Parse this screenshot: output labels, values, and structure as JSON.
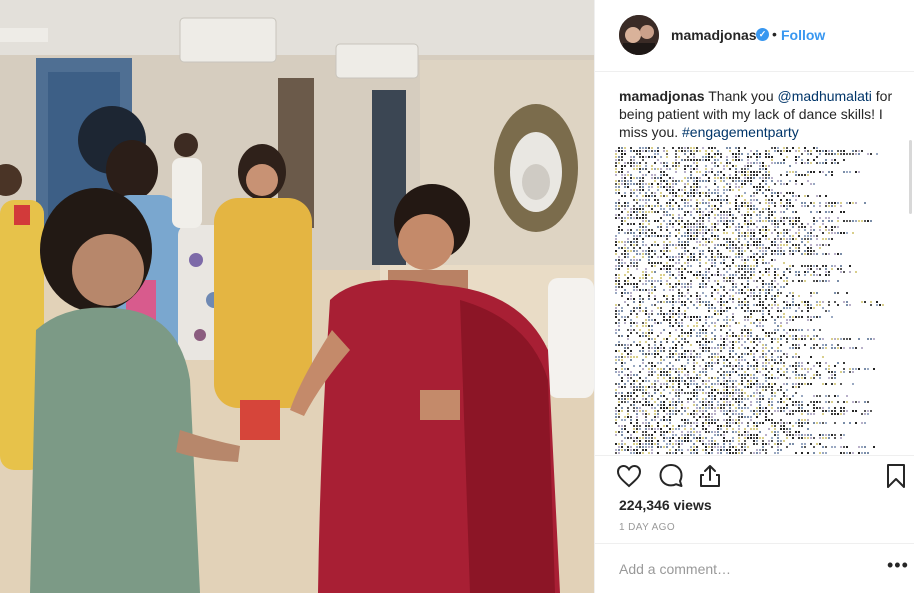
{
  "post": {
    "username": "mamadjonas",
    "verified_glyph": "✓",
    "separator": "•",
    "follow_label": "Follow",
    "caption": {
      "username": "mamadjonas",
      "text_1": " Thank you ",
      "mention": "@madhumalati",
      "text_2": " for being patient with my lack of dance skills! I miss you. ",
      "hashtag": "#engagementparty"
    },
    "views": "224,346 views",
    "timestamp": "1 DAY AGO",
    "comment_placeholder": "Add a comment…",
    "more_glyph": "•••"
  },
  "icons": {
    "like": "heart-icon",
    "comment": "comment-icon",
    "share": "share-icon",
    "save": "bookmark-icon",
    "verified": "verified-badge-icon"
  },
  "colors": {
    "link": "#3897f0",
    "hashtag": "#003569",
    "muted": "#999999",
    "text": "#262626"
  }
}
